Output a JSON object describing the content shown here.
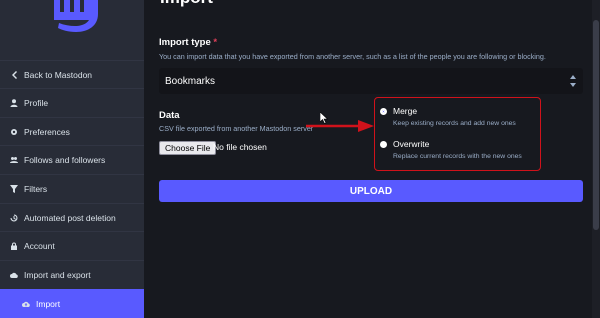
{
  "sidebar": {
    "items": [
      {
        "label": "Back to Mastodon",
        "icon": "chevron-left-icon"
      },
      {
        "label": "Profile",
        "icon": "user-icon"
      },
      {
        "label": "Preferences",
        "icon": "cog-icon"
      },
      {
        "label": "Follows and followers",
        "icon": "users-icon"
      },
      {
        "label": "Filters",
        "icon": "filter-icon"
      },
      {
        "label": "Automated post deletion",
        "icon": "history-icon"
      },
      {
        "label": "Account",
        "icon": "lock-icon"
      },
      {
        "label": "Import and export",
        "icon": "cloud-icon"
      },
      {
        "label": "Import",
        "icon": "cloud-upload-icon"
      }
    ]
  },
  "page": {
    "title": "Import"
  },
  "form": {
    "import_type_label": "Import type",
    "required_mark": "*",
    "import_type_hint": "You can import data that you have exported from another server, such as a list of the people you are following or blocking.",
    "import_type_value": "Bookmarks",
    "data_label": "Data",
    "data_hint": "CSV file exported from another Mastodon server",
    "choose_file_label": "Choose File",
    "file_status": "No file chosen",
    "modes": [
      {
        "title": "Merge",
        "desc": "Keep existing records and add new ones",
        "checked": true
      },
      {
        "title": "Overwrite",
        "desc": "Replace current records with the new ones",
        "checked": false
      }
    ],
    "upload_label": "UPLOAD"
  },
  "colors": {
    "accent": "#595aff",
    "annotation": "#d0121b",
    "sidebar_bg": "#282c37",
    "main_bg": "#17191f"
  }
}
